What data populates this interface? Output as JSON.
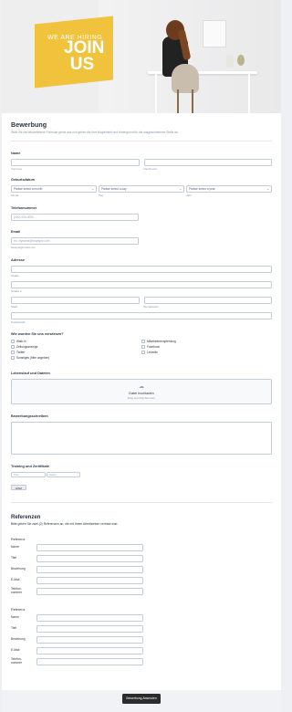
{
  "hero": {
    "line1": "WE ARE HIRING",
    "line2": "JOIN US"
  },
  "form": {
    "title": "Bewerbung",
    "subtitle": "Stellt Sie die beschriebene Formular gerne aus und geben die Ihre Möglichkeit und Hintergrund für die ausgeschriebene Stelle an.",
    "name": {
      "label": "Name",
      "first": "Vorname",
      "last": "Nachname"
    },
    "dob": {
      "label": "Geburtsdatum",
      "month": "Please select a month",
      "day": "Please select a day",
      "year": "Please select a year",
      "month_sub": "Monat",
      "day_sub": "Tag",
      "year_sub": "Jahr"
    },
    "phone": {
      "label": "Telefonnummer",
      "placeholder": "(000) 000-0000"
    },
    "email": {
      "label": "Email",
      "placeholder": "ex: myname@example.com",
      "sub": "beispiel@email.com"
    },
    "address": {
      "label": "Adresse",
      "street1": "Straße",
      "street2": "Straße 2",
      "city": "Stadt",
      "state": "Bundesland",
      "zip": "Postleitzahl"
    },
    "source": {
      "label": "Wie wurden Sie uns verwiesen?",
      "col1": [
        "Walk-In",
        "Zeitungsanzeige",
        "Twitter",
        "Sonstiges (bitte angeben)"
      ],
      "col2": [
        "Mitarbeiterempfehlung",
        "Facebook",
        "LinkedIn"
      ]
    },
    "cv": {
      "label": "Lebenslauf und Dateien",
      "title": "Datei hochladen",
      "sub": "Drag and drop files here"
    },
    "letter": {
      "label": "Bewerbungsschreiben"
    },
    "training": {
      "label": "Training und Zertifikate",
      "col1": "Titel",
      "col2": "Datum",
      "add": "HINZ"
    },
    "refs": {
      "title": "Referenzen",
      "intro": "Bitte geben Sie zwei (2) Referenzen an, die mit Ihrem Arbeitsleben vertraut sind.",
      "ref_label": "Referenz",
      "fields": [
        "Name",
        "Titel",
        "Beziehung",
        "E-Mail",
        "Telefon-\nnummer"
      ]
    },
    "submit": "Bewerbung Absenden"
  }
}
